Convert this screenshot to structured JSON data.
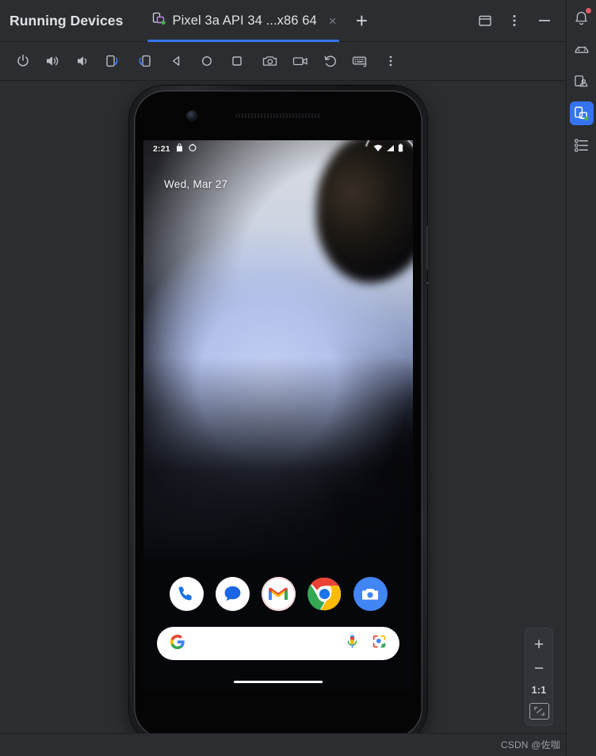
{
  "window": {
    "panel_title": "Running Devices",
    "accent_color": "#3574f0",
    "background_color": "#2b2d30"
  },
  "tabs": [
    {
      "label": "Pixel 3a API 34 ...x86 64",
      "icon": "device-emulator-icon",
      "close_label": "×",
      "active": true,
      "running_indicator_color": "#4caf50"
    }
  ],
  "tab_add_label": "+",
  "header_buttons": [
    {
      "name": "split-window-button",
      "icon": "window-split-icon"
    },
    {
      "name": "more-options-button",
      "icon": "vertical-dots-icon"
    },
    {
      "name": "minimize-button",
      "icon": "minimize-icon"
    }
  ],
  "toolbar": [
    {
      "name": "power-button",
      "icon": "power-icon",
      "tooltip": "Power"
    },
    {
      "name": "volume-up-button",
      "icon": "volume-up-icon",
      "tooltip": "Volume Up"
    },
    {
      "name": "volume-down-button",
      "icon": "volume-down-icon",
      "tooltip": "Volume Down"
    },
    {
      "name": "rotate-left-button",
      "icon": "rotate-left-icon",
      "tooltip": "Rotate Left"
    },
    {
      "name": "rotate-right-button",
      "icon": "rotate-right-icon",
      "tooltip": "Rotate Right"
    },
    {
      "name": "back-button",
      "icon": "back-triangle-icon",
      "tooltip": "Back"
    },
    {
      "name": "home-button",
      "icon": "home-circle-icon",
      "tooltip": "Home"
    },
    {
      "name": "overview-button",
      "icon": "overview-square-icon",
      "tooltip": "Overview"
    },
    {
      "name": "screenshot-button",
      "icon": "camera-icon",
      "tooltip": "Take Screenshot"
    },
    {
      "name": "record-button",
      "icon": "video-camera-icon",
      "tooltip": "Record Screen"
    },
    {
      "name": "back-again-button",
      "icon": "rotate-back-icon",
      "tooltip": "Back"
    },
    {
      "name": "keyboard-button",
      "icon": "keyboard-icon",
      "tooltip": "Hardware Input"
    },
    {
      "name": "toolbar-more-button",
      "icon": "vertical-dots-icon",
      "tooltip": "More"
    }
  ],
  "device": {
    "status_bar": {
      "time": "2:21",
      "left_icons": [
        "bag-icon",
        "circle-icon"
      ],
      "right_icons": [
        "wifi-icon",
        "signal-icon",
        "battery-icon"
      ]
    },
    "date_text": "Wed, Mar 27",
    "dock_apps": [
      {
        "name": "app-icon-phone",
        "label": "Phone"
      },
      {
        "name": "app-icon-messages",
        "label": "Messages"
      },
      {
        "name": "app-icon-gmail",
        "label": "Gmail"
      },
      {
        "name": "app-icon-chrome",
        "label": "Chrome"
      },
      {
        "name": "app-icon-camera",
        "label": "Camera"
      }
    ],
    "search": {
      "value": "",
      "placeholder": "",
      "left_icon": "google-g-icon",
      "right_icons": [
        "microphone-icon",
        "google-lens-icon"
      ]
    },
    "home_indicator": "home-indicator-bar"
  },
  "zoom_controls": {
    "zoom_in_label": "+",
    "zoom_out_label": "−",
    "actual_size_label": "1:1",
    "fit_label": "fit-to-screen-icon"
  },
  "tool_sidebar": [
    {
      "name": "sidebar-item-notifications",
      "icon": "bell-icon",
      "active": false,
      "badge": true
    },
    {
      "name": "sidebar-item-emulator",
      "icon": "emulator-icon",
      "active": false,
      "badge": false
    },
    {
      "name": "sidebar-item-layout-inspector",
      "icon": "layout-inspector-icon",
      "active": false,
      "badge": false
    },
    {
      "name": "sidebar-item-running-devices",
      "icon": "running-devices-icon",
      "active": true,
      "badge": false
    },
    {
      "name": "sidebar-item-structure",
      "icon": "structure-list-icon",
      "active": false,
      "badge": false
    }
  ],
  "watermark": "CSDN @佐咖"
}
